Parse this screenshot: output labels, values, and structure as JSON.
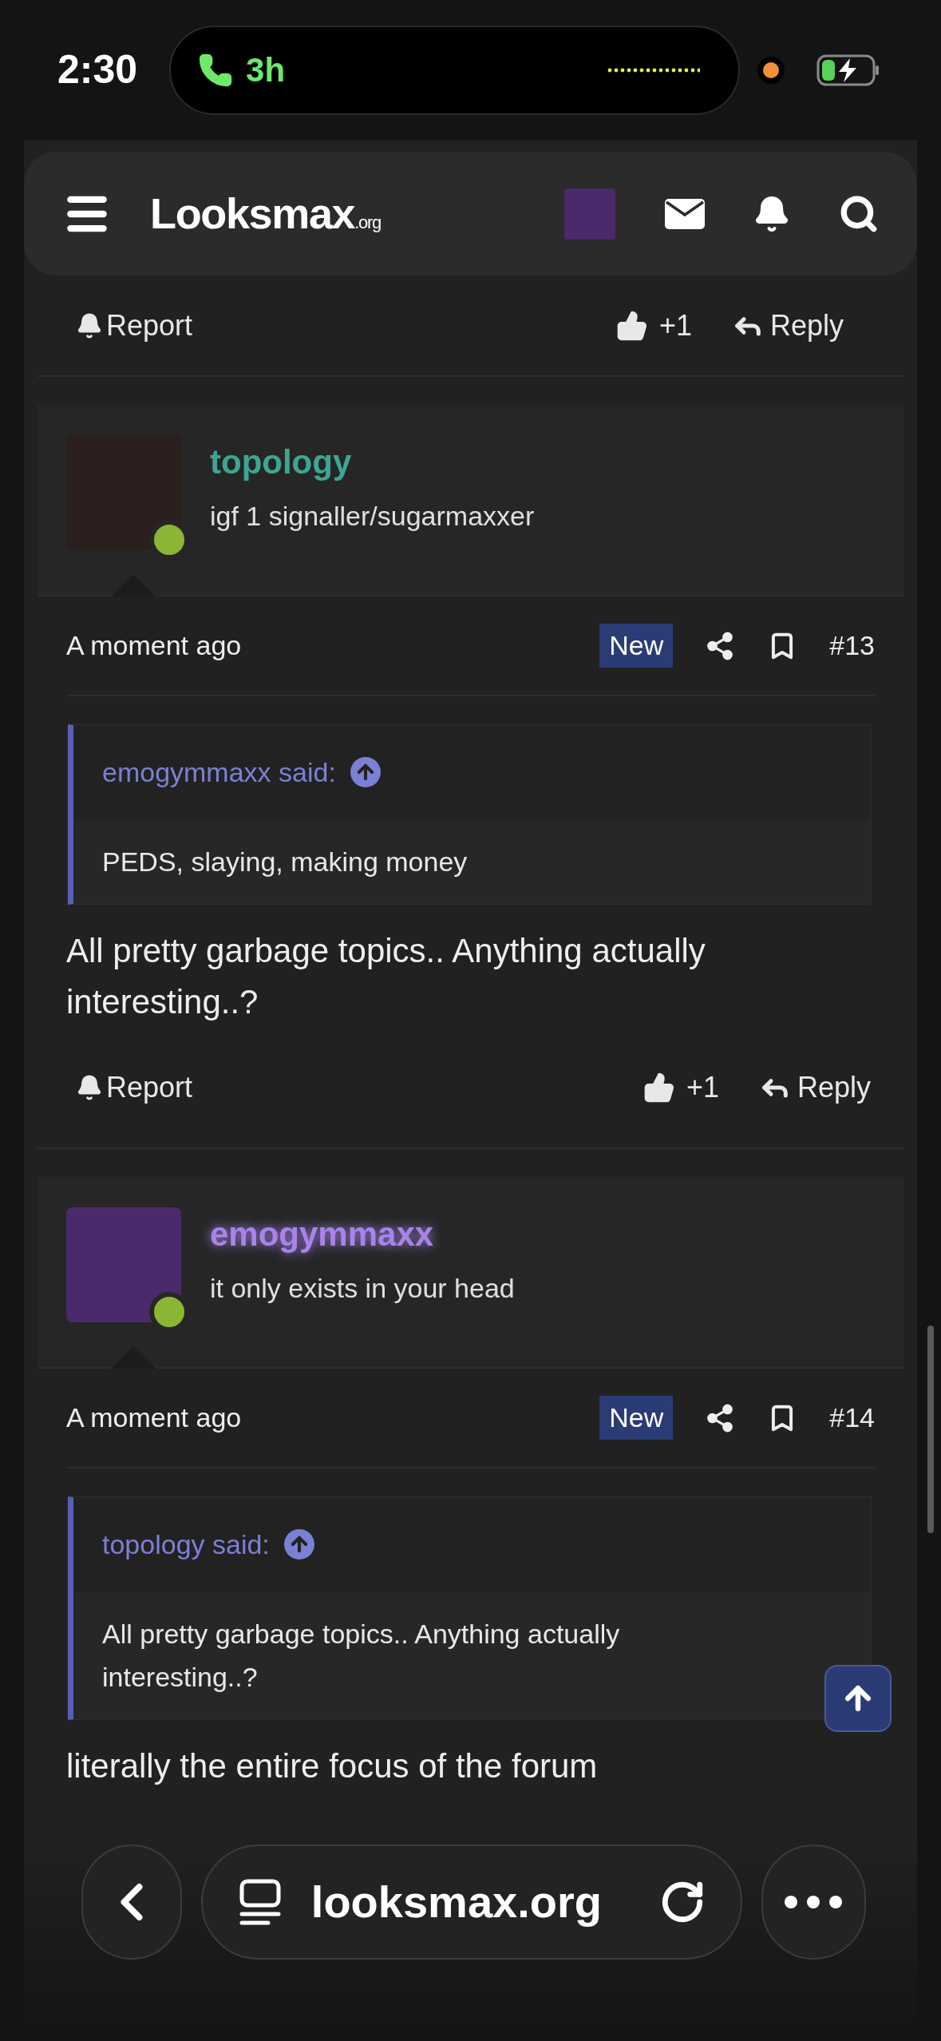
{
  "status_bar": {
    "time": "2:30",
    "call_duration": "3h"
  },
  "header": {
    "logo": "Looksmax",
    "logo_suffix": ".org"
  },
  "top_actions": {
    "report": "Report",
    "like": "+1",
    "reply": "Reply"
  },
  "posts": [
    {
      "author": "topology",
      "color": "#3ea593",
      "glow": false,
      "title": "igf 1 signaller/sugarmaxxer",
      "online": true,
      "time": "A moment ago",
      "badge": "New",
      "number": "#13",
      "quote": {
        "author": "emogymmaxx said:",
        "text": "PEDS, slaying, making money"
      },
      "body": "All pretty garbage topics.. Anything actually interesting..?",
      "actions": {
        "report": "Report",
        "like": "+1",
        "reply": "Reply"
      }
    },
    {
      "author": "emogymmaxx",
      "color": "#a983ea",
      "glow": true,
      "title": "it only exists in your head",
      "online": true,
      "time": "A moment ago",
      "badge": "New",
      "number": "#14",
      "quote": {
        "author": "topology said:",
        "text": "All pretty garbage topics.. Anything actually interesting..?"
      },
      "body": "literally the entire focus of the forum"
    }
  ],
  "browser_bar": {
    "url": "looksmax.org"
  }
}
